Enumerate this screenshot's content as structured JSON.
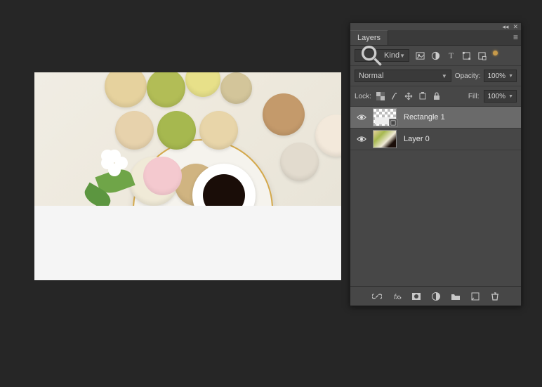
{
  "panel": {
    "tab_label": "Layers",
    "filter": {
      "kind_label": "Kind"
    },
    "blend": {
      "mode_label": "Normal",
      "opacity_label": "Opacity:",
      "opacity_value": "100%"
    },
    "lock": {
      "label": "Lock:",
      "fill_label": "Fill:",
      "fill_value": "100%"
    },
    "layers": [
      {
        "name": "Rectangle 1",
        "type": "shape",
        "visible": true,
        "selected": true
      },
      {
        "name": "Layer 0",
        "type": "raster",
        "visible": true,
        "selected": false
      }
    ]
  },
  "icons": {
    "search": "search-icon",
    "collapse": "◂◂",
    "close": "✕",
    "flyout": "≡"
  }
}
